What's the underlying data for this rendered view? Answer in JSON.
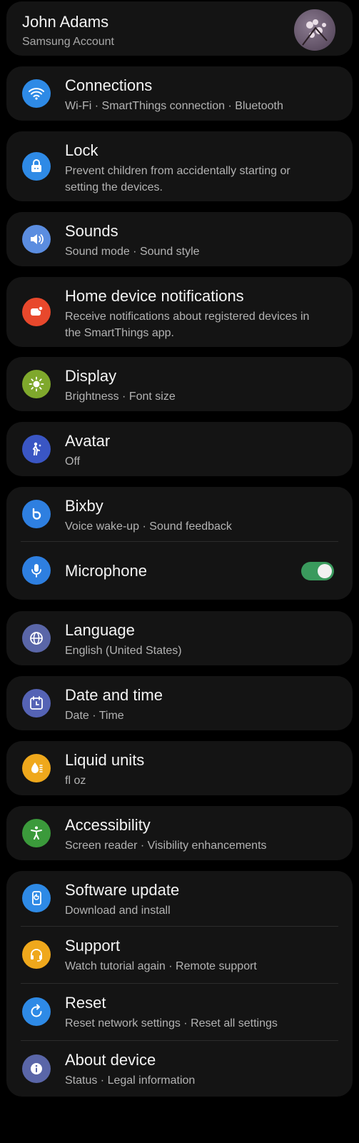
{
  "account": {
    "name": "John Adams",
    "subtitle": "Samsung Account"
  },
  "items": {
    "connections": {
      "title": "Connections",
      "subtitle": "Wi-Fi · SmartThings connection · Bluetooth",
      "icon": "wifi-icon",
      "color": "#2e8ae6"
    },
    "lock": {
      "title": "Lock",
      "subtitle1": "Prevent children from accidentally starting or",
      "subtitle2": "setting the devices.",
      "icon": "lock-icon",
      "color": "#2e8ae6"
    },
    "sounds": {
      "title": "Sounds",
      "subtitle": "Sound mode · Sound style",
      "icon": "speaker-icon",
      "color": "#5b8de0"
    },
    "home_notifications": {
      "title": "Home device notifications",
      "subtitle1": "Receive notifications about registered devices in",
      "subtitle2": "the SmartThings app.",
      "icon": "notification-icon",
      "color": "#e8482c"
    },
    "display": {
      "title": "Display",
      "subtitle": "Brightness · Font size",
      "icon": "sun-icon",
      "color": "#7fa82c"
    },
    "avatar": {
      "title": "Avatar",
      "subtitle": "Off",
      "icon": "person-icon",
      "color": "#3a56c4"
    },
    "bixby": {
      "title": "Bixby",
      "subtitle": "Voice wake-up · Sound feedback",
      "icon": "bixby-icon",
      "color": "#2e7fe0"
    },
    "microphone": {
      "title": "Microphone",
      "icon": "microphone-icon",
      "color": "#2e7fe0",
      "enabled": true
    },
    "language": {
      "title": "Language",
      "subtitle": "English (United States)",
      "icon": "globe-icon",
      "color": "#5a66a8"
    },
    "datetime": {
      "title": "Date and time",
      "subtitle": "Date · Time",
      "icon": "calendar-clock-icon",
      "color": "#5563b5"
    },
    "liquid_units": {
      "title": "Liquid units",
      "subtitle": "fl oz",
      "icon": "droplet-icon",
      "color": "#efa81c"
    },
    "accessibility": {
      "title": "Accessibility",
      "subtitle": "Screen reader · Visibility enhancements",
      "icon": "accessibility-icon",
      "color": "#3b9a3b"
    },
    "software_update": {
      "title": "Software update",
      "subtitle": "Download and install",
      "icon": "update-icon",
      "color": "#2e8ae6"
    },
    "support": {
      "title": "Support",
      "subtitle": "Watch tutorial again · Remote support",
      "icon": "headset-icon",
      "color": "#efa81c"
    },
    "reset": {
      "title": "Reset",
      "subtitle": "Reset network settings · Reset all settings",
      "icon": "reset-icon",
      "color": "#2e8ae6"
    },
    "about": {
      "title": "About device",
      "subtitle": "Status · Legal information",
      "icon": "info-icon",
      "color": "#5a66a8"
    }
  }
}
